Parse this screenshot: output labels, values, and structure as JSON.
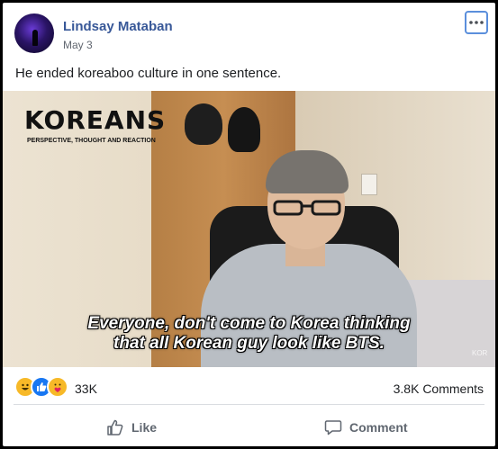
{
  "post": {
    "author": "Lindsay Mataban",
    "date": "May 3",
    "caption": "He ended koreaboo culture in one sentence."
  },
  "video": {
    "logo": "KOREANS",
    "logo_sub": "PERSPECTIVE, THOUGHT AND REACTION",
    "subtitle_line1": "Everyone, don't come to Korea thinking",
    "subtitle_line2": "that all Korean guy look like BTS.",
    "watermark": "KOR"
  },
  "stats": {
    "reactions": "33K",
    "comments": "3.8K Comments",
    "reaction_icons": [
      "haha-icon",
      "like-icon",
      "care-icon"
    ]
  },
  "actions": {
    "like_label": "Like",
    "comment_label": "Comment"
  },
  "colors": {
    "author": "#385898",
    "like_blue": "#1877f2",
    "haha_yellow": "#f7b928",
    "focus_outline": "#5b8fdc"
  }
}
